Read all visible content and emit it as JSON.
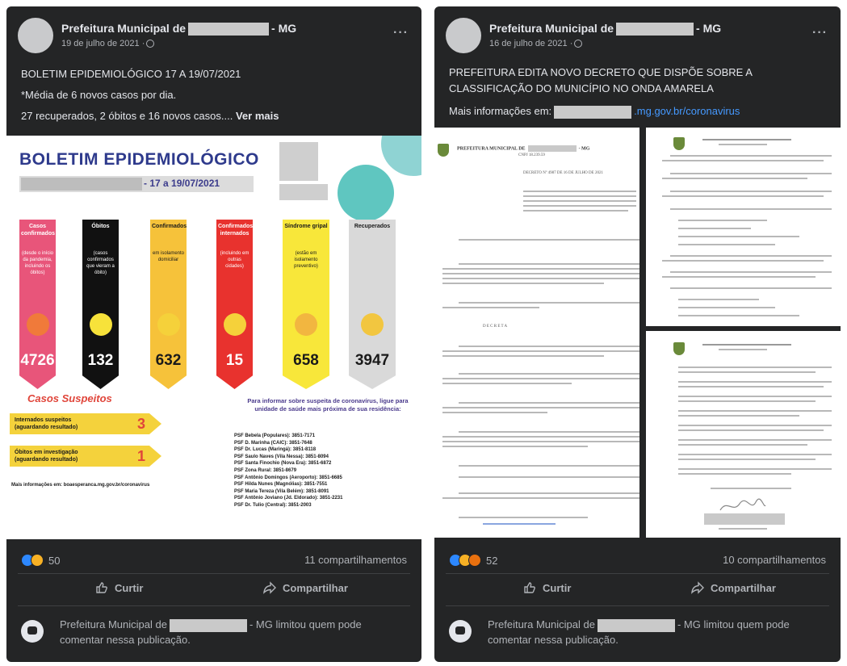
{
  "posts": [
    {
      "author_prefix": "Prefeitura Municipal de",
      "author_suffix": "- MG",
      "date": "19 de julho de 2021 ·",
      "more": "···",
      "text": {
        "line1": "BOLETIM EPIDEMIOLÓGICO 17 A 19/07/2021",
        "line2": "*Média de 6 novos casos por dia.",
        "line3": "27 recuperados, 2 óbitos e 16 novos casos....",
        "see_more": "Ver mais"
      },
      "infographic": {
        "title": "BOLETIM EPIDEMIOLÓGICO",
        "date_range": "- 17 a 19/07/2021",
        "columns": [
          {
            "label": "Casos confirmados",
            "desc": "(desde o início da pandemia, incluindo os óbitos)",
            "value": "4726",
            "bg": "#e8557a",
            "fg": "#ffffff",
            "icon_color": "#f07a3a"
          },
          {
            "label": "Óbitos",
            "desc": "(casos confirmados que vieram a óbito)",
            "value": "132",
            "bg": "#111111",
            "fg": "#ffffff",
            "icon_color": "#f7e23a"
          },
          {
            "label": "Confirmados",
            "desc": "em isolamento domiciliar",
            "value": "632",
            "bg": "#f6c23a",
            "fg": "#1a1a1a",
            "icon_color": "#f5d13a"
          },
          {
            "label": "Confirmados internados",
            "desc": "(incluindo em outras cidades)",
            "value": "15",
            "bg": "#e8322e",
            "fg": "#ffffff",
            "icon_color": "#f5d13a"
          },
          {
            "label": "Síndrome gripal",
            "desc": "(estão em isolamento preventivo)",
            "value": "658",
            "bg": "#f8e73a",
            "fg": "#1a1a1a",
            "icon_color": "#f2b640"
          },
          {
            "label": "Recuperados",
            "desc": "",
            "value": "3947",
            "bg": "#d9d9d9",
            "fg": "#1a1a1a",
            "icon_color": "#f2c640"
          }
        ],
        "suspects_title": "Casos Suspeitos",
        "suspects": [
          {
            "label": "Internados suspeitos",
            "sub": "(aguardando resultado)",
            "value": "3"
          },
          {
            "label": "Óbitos em investigação",
            "sub": "(aguardando resultado)",
            "value": "1"
          }
        ],
        "more_info": "Mais informações em: boaesperanca.mg.gov.br/coronavirus",
        "contact_title": "Para informar sobre suspeita de coronavírus, ligue para unidade de saúde mais próxima de sua residência:",
        "contacts": [
          "PSF Bebela (Populares): 3851-7171",
          "PSF D. Marinha (CAIC): 3851-7648",
          "PSF Dr. Lucas (Maringá): 3851-8118",
          "PSF Saulo Naves (Vila Nessa): 3851-8094",
          "PSF Santa Finochio (Nova Era): 3851-6872",
          "PSF Zona Rural: 3851-8679",
          "PSF Antônio Domingos (Aeroporto): 3851-6685",
          "PSF Hilda Nunes (Magnólias): 3851-7551",
          "PSF Maria Tereza (Vila Belém): 3851-8091",
          "PSF Antônio Joviano (Jd. Eldorado): 3851-2231",
          "PSF Dr. Tulio (Central): 3851-2003"
        ]
      },
      "reaction_count": "50",
      "shares": "11 compartilhamentos",
      "like": "Curtir",
      "share": "Compartilhar",
      "notice_prefix": "Prefeitura Municipal de",
      "notice_suffix": "- MG limitou quem pode comentar nessa publicação."
    },
    {
      "author_prefix": "Prefeitura Municipal de",
      "author_suffix": "- MG",
      "date": "16 de julho de 2021 ·",
      "more": "···",
      "text": {
        "line1": "PREFEITURA EDITA NOVO DECRETO QUE DISPÕE SOBRE A",
        "line2": "CLASSIFICAÇÃO DO MUNICÍPIO NO ONDA AMARELA",
        "line3_prefix": "Mais informações em:",
        "link": ".mg.gov.br/coronavirus"
      },
      "document": {
        "header": "PREFEITURA MUNICIPAL DE",
        "header_suffix": "- MG",
        "cnpj": "CNPJ 18.239.59",
        "decree": "DECRETO Nº 4987 DE 16 DE JULHO DE 2021",
        "decreta": "D E C R E T A"
      },
      "reaction_count": "52",
      "shares": "10 compartilhamentos",
      "like": "Curtir",
      "share": "Compartilhar",
      "notice_prefix": "Prefeitura Municipal de",
      "notice_suffix": "- MG limitou quem pode comentar nessa publicação."
    }
  ]
}
